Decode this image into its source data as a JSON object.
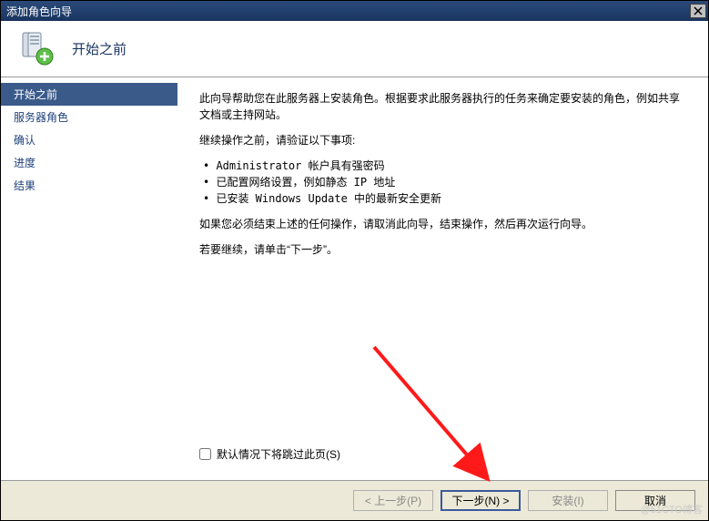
{
  "window": {
    "title": "添加角色向导"
  },
  "header": {
    "title": "开始之前"
  },
  "sidebar": {
    "items": [
      {
        "label": "开始之前",
        "active": true
      },
      {
        "label": "服务器角色",
        "active": false
      },
      {
        "label": "确认",
        "active": false
      },
      {
        "label": "进度",
        "active": false
      },
      {
        "label": "结果",
        "active": false
      }
    ]
  },
  "content": {
    "intro": "此向导帮助您在此服务器上安装角色。根据要求此服务器执行的任务来确定要安装的角色，例如共享文档或主持网站。",
    "verify_heading": "继续操作之前，请验证以下事项:",
    "bullets": [
      "Administrator 帐户具有强密码",
      "已配置网络设置，例如静态 IP 地址",
      "已安装 Windows Update 中的最新安全更新"
    ],
    "note1": "如果您必须结束上述的任何操作，请取消此向导，结束操作，然后再次运行向导。",
    "note2": "若要继续，请单击“下一步”。",
    "skip_label": "默认情况下将跳过此页(S)"
  },
  "footer": {
    "prev": "< 上一步(P)",
    "next": "下一步(N) >",
    "install": "安装(I)",
    "cancel": "取消"
  },
  "watermark": "@51CTO博客"
}
